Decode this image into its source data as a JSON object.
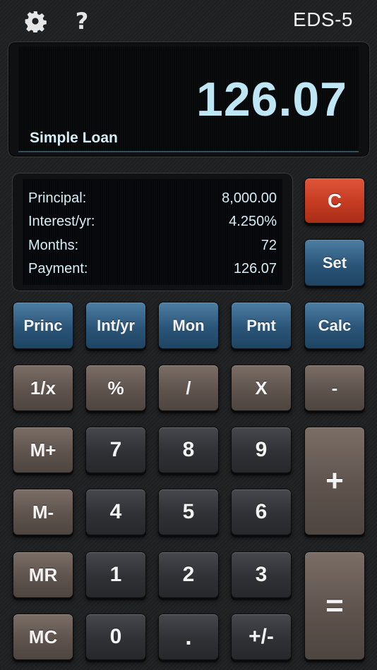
{
  "header": {
    "settings_icon": "gear-icon",
    "help_label": "?",
    "model": "EDS-5"
  },
  "display": {
    "value": "126.07",
    "mode": "Simple Loan"
  },
  "info": {
    "rows": [
      {
        "label": "Principal:",
        "value": "8,000.00"
      },
      {
        "label": "Interest/yr:",
        "value": "4.250%"
      },
      {
        "label": "Months:",
        "value": "72"
      },
      {
        "label": "Payment:",
        "value": "126.07"
      }
    ]
  },
  "keys": {
    "clear": "C",
    "set": "Set",
    "princ": "Princ",
    "int_yr": "Int/yr",
    "mon": "Mon",
    "pmt": "Pmt",
    "calc": "Calc",
    "reciprocal": "1/x",
    "percent": "%",
    "divide": "/",
    "multiply": "X",
    "minus": "-",
    "m_plus": "M+",
    "m_minus": "M-",
    "mr": "MR",
    "mc": "MC",
    "d7": "7",
    "d8": "8",
    "d9": "9",
    "d4": "4",
    "d5": "5",
    "d6": "6",
    "d1": "1",
    "d2": "2",
    "d3": "3",
    "d0": "0",
    "dot": ".",
    "sign": "+/-",
    "plus": "+",
    "equals": "="
  },
  "colors": {
    "blue_key": "#2a5578",
    "red_key": "#c53b22",
    "brown_key": "#5e534d",
    "dark_key": "#2f3135",
    "display_text": "#bfe6f4"
  }
}
